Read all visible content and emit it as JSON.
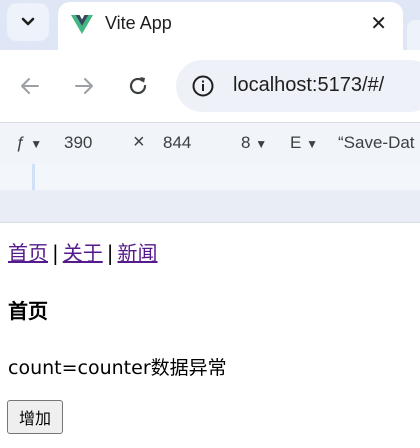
{
  "browser": {
    "tab": {
      "title": "Vite App",
      "close_glyph": "✕",
      "favicon": "vite-logo-icon"
    },
    "tab_search_icon": "chevron-down-icon",
    "toolbar": {
      "back_icon": "arrow-left-icon",
      "forward_icon": "arrow-right-icon",
      "reload_icon": "reload-icon",
      "site_info_icon": "info-icon",
      "url": "localhost:5173/#/"
    },
    "device_toolbar": {
      "device_label": "ƒ",
      "width_value": "390",
      "times": "×",
      "height_value": "844",
      "zoom_label": "8",
      "throttle_label": "E",
      "save_data_label": "“Save-Dat"
    }
  },
  "page": {
    "nav": [
      {
        "label": "首页"
      },
      {
        "label": "关于"
      },
      {
        "label": "新闻"
      }
    ],
    "separator": "|",
    "heading": "首页",
    "count_text": "count=counter数据异常",
    "add_button": "增加"
  },
  "colors": {
    "tabstrip_bg": "#dfe7f6",
    "omnibox_bg": "#eef1f7",
    "visited_link": "#551a8b",
    "vite_green": "#41b883"
  }
}
